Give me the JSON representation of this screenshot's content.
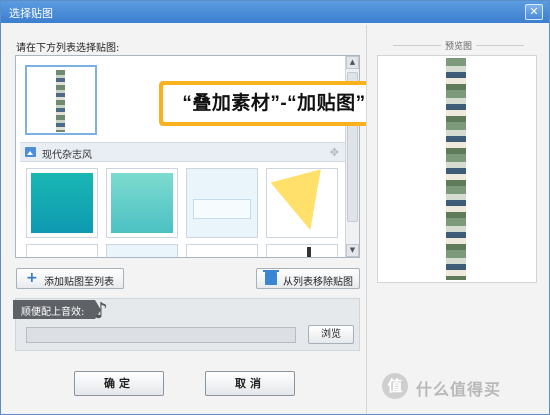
{
  "window": {
    "title": "选择贴图",
    "close_glyph": "✕"
  },
  "list": {
    "label": "请在下方列表选择贴图:",
    "category": "现代杂志风",
    "callout": "“叠加素材”-“加贴图”"
  },
  "scrollbar": {
    "up": "▲",
    "down": "▼"
  },
  "actions": {
    "add_label": "添加贴图至列表",
    "add_glyph": "+",
    "remove_label": "从列表移除贴图"
  },
  "music": {
    "tab_label": "顺便配上音效:",
    "note_glyph": "♪",
    "browse_label": "浏览",
    "file_value": ""
  },
  "dialog_buttons": {
    "ok_label": "确定",
    "cancel_label": "取消"
  },
  "preview": {
    "title": "预览图"
  },
  "watermark": {
    "glyph": "值",
    "text": "什么值得买"
  },
  "colors": {
    "title_bar": "#3c7fcf",
    "callout_border": "#f9b21e",
    "accent_blue": "#2f79c9"
  }
}
